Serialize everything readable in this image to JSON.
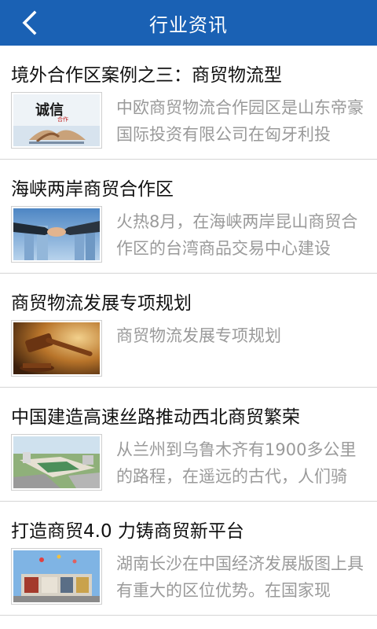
{
  "header": {
    "title": "行业资讯",
    "back_icon": "chevron-left-icon"
  },
  "theme": {
    "header_bg": "#1a61b4",
    "title_color": "#111111",
    "desc_color": "#9a9a9a"
  },
  "items": [
    {
      "title": "境外合作区案例之三：商贸物流型",
      "desc": "中欧商贸物流合作园区是山东帝豪国际投资有限公司在匈牙利投",
      "thumb_label": "诚信",
      "thumb_sub": "合作"
    },
    {
      "title": "海峡两岸商贸合作区",
      "desc": "火热8月，在海峡两岸昆山商贸合作区的台湾商品交易中心建设"
    },
    {
      "title": "商贸物流发展专项规划",
      "desc": "商贸物流发展专项规划"
    },
    {
      "title": "中国建造高速丝路推动西北商贸繁荣",
      "desc": "从兰州到乌鲁木齐有1900多公里的路程，在遥远的古代，人们骑"
    },
    {
      "title": "打造商贸4.0 力铸商贸新平台",
      "desc": "湖南长沙在中国经济发展版图上具有重大的区位优势。在国家现"
    }
  ]
}
